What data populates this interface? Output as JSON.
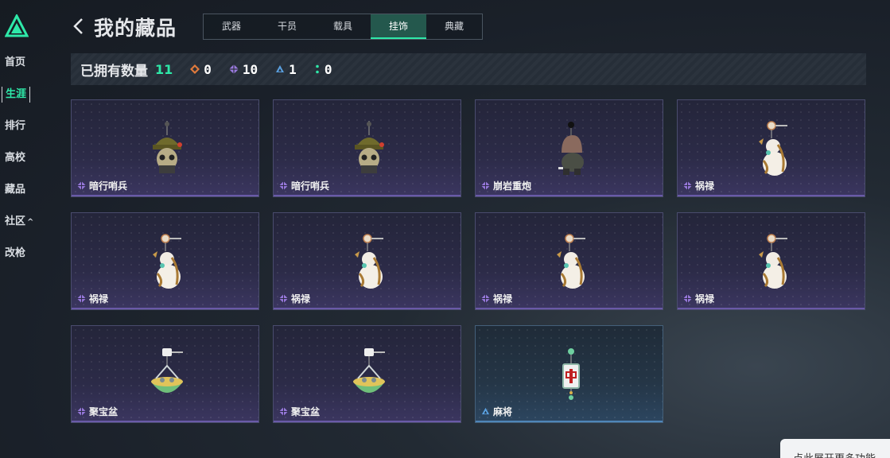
{
  "sidebar": {
    "items": [
      {
        "label": "首页",
        "active": false
      },
      {
        "label": "生涯",
        "active": true
      },
      {
        "label": "排行",
        "active": false
      },
      {
        "label": "高校",
        "active": false
      },
      {
        "label": "藏品",
        "active": false
      },
      {
        "label": "社区",
        "active": false,
        "suffix": "^"
      },
      {
        "label": "改枪",
        "active": false
      }
    ]
  },
  "header": {
    "title": "我的藏品",
    "tabs": [
      {
        "label": "武器",
        "active": false
      },
      {
        "label": "干员",
        "active": false
      },
      {
        "label": "载具",
        "active": false
      },
      {
        "label": "挂饰",
        "active": true
      },
      {
        "label": "典藏",
        "active": false
      }
    ]
  },
  "summary": {
    "label": "已拥有数量",
    "total": "11",
    "rarities": [
      {
        "icon": "orange-diamond-icon",
        "color": "#e07a3c",
        "count": "0"
      },
      {
        "icon": "purple-diamond-icon",
        "color": "#9b7be0",
        "count": "10"
      },
      {
        "icon": "blue-triangle-icon",
        "color": "#5aa0e0",
        "count": "1"
      },
      {
        "icon": "green-dots-icon",
        "color": "#2ee8a8",
        "count": "0"
      }
    ]
  },
  "items": [
    {
      "name": "暗行哨兵",
      "rarity": "purple",
      "icon": "skull-helmet-charm-icon"
    },
    {
      "name": "暗行哨兵",
      "rarity": "purple",
      "icon": "skull-helmet-charm-icon"
    },
    {
      "name": "崩岩重炮",
      "rarity": "purple",
      "icon": "hooded-figure-charm-icon"
    },
    {
      "name": "祸禄",
      "rarity": "purple",
      "icon": "gourd-charm-icon"
    },
    {
      "name": "祸禄",
      "rarity": "purple",
      "icon": "gourd-charm-icon"
    },
    {
      "name": "祸禄",
      "rarity": "purple",
      "icon": "gourd-charm-icon"
    },
    {
      "name": "祸禄",
      "rarity": "purple",
      "icon": "gourd-charm-icon"
    },
    {
      "name": "祸禄",
      "rarity": "purple",
      "icon": "gourd-charm-icon"
    },
    {
      "name": "聚宝盆",
      "rarity": "purple",
      "icon": "treasure-bowl-charm-icon"
    },
    {
      "name": "聚宝盆",
      "rarity": "purple",
      "icon": "treasure-bowl-charm-icon"
    },
    {
      "name": "麻将",
      "rarity": "blue",
      "icon": "mahjong-tile-charm-icon"
    }
  ],
  "hint": {
    "text": "点此展开更多功能"
  },
  "colors": {
    "accent": "#2ee8a8",
    "purple": "#9b7be0",
    "blue": "#5aa0e0"
  }
}
